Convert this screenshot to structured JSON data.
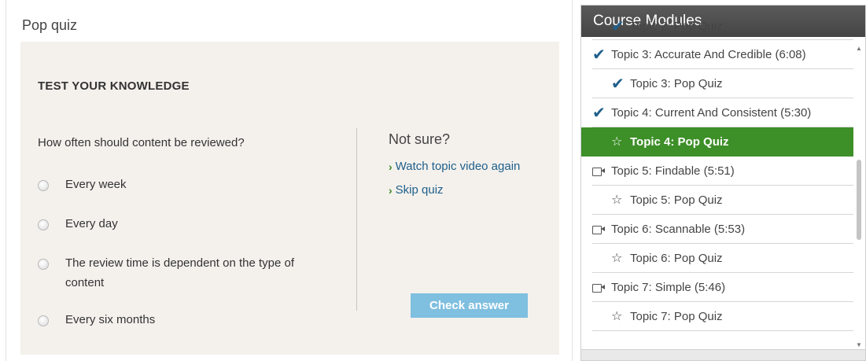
{
  "page": {
    "title": "Pop quiz"
  },
  "quiz": {
    "heading": "TEST YOUR KNOWLEDGE",
    "question": "How often should content be reviewed?",
    "options": [
      {
        "label": "Every week"
      },
      {
        "label": "Every day"
      },
      {
        "label": "The review time is dependent on the type of content"
      },
      {
        "label": "Every six months"
      }
    ],
    "help": {
      "title": "Not sure?",
      "links": [
        {
          "label": "Watch topic video again"
        },
        {
          "label": "Skip quiz"
        }
      ]
    },
    "check_button": "Check answer"
  },
  "modules": {
    "title": "Course Modules",
    "items": [
      {
        "label": "Topic 2: Pop Quiz",
        "icon": "checkmark-icon"
      },
      {
        "label": "Topic 3: Accurate And Credible (6:08)",
        "icon": "checkmark-icon"
      },
      {
        "label": "Topic 3: Pop Quiz",
        "icon": "checkmark-icon"
      },
      {
        "label": "Topic 4: Current And Consistent (5:30)",
        "icon": "checkmark-icon"
      },
      {
        "label": "Topic 4: Pop Quiz",
        "icon": "star-icon",
        "active": true
      },
      {
        "label": "Topic 5: Findable (5:51)",
        "icon": "video-camera-icon"
      },
      {
        "label": "Topic 5: Pop Quiz",
        "icon": "star-icon"
      },
      {
        "label": "Topic 6: Scannable (5:53)",
        "icon": "video-camera-icon"
      },
      {
        "label": "Topic 6: Pop Quiz",
        "icon": "star-icon"
      },
      {
        "label": "Topic 7: Simple (5:46)",
        "icon": "video-camera-icon"
      },
      {
        "label": "Topic 7: Pop Quiz",
        "icon": "star-icon"
      }
    ]
  },
  "colors": {
    "accent_green": "#3d8f28",
    "link_blue": "#1f5f8b",
    "button_blue": "#7fbfe0",
    "header_gray": "#4f4f4f",
    "card_bg": "#f4f1ed"
  }
}
